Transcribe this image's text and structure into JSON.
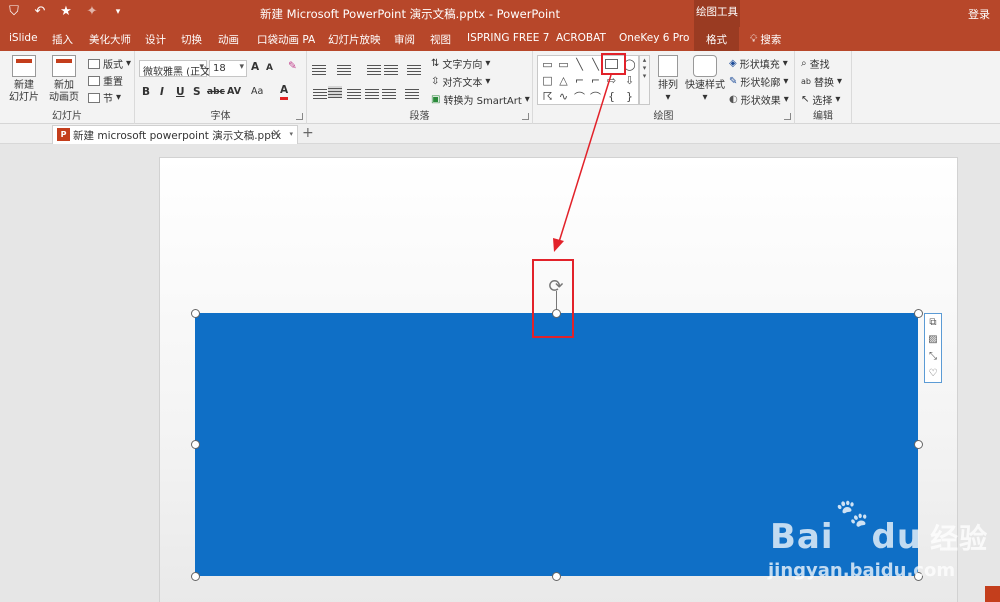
{
  "titlebar": {
    "title": "新建 Microsoft PowerPoint 演示文稿.pptx  -  PowerPoint",
    "context_tool": "绘图工具",
    "login": "登录"
  },
  "tabs": [
    {
      "label": "iSlide"
    },
    {
      "label": "插入"
    },
    {
      "label": "美化大师"
    },
    {
      "label": "设计"
    },
    {
      "label": "切换"
    },
    {
      "label": "动画"
    },
    {
      "label": "口袋动画 PA"
    },
    {
      "label": "幻灯片放映"
    },
    {
      "label": "审阅"
    },
    {
      "label": "视图"
    },
    {
      "label": "ISPRING FREE 7"
    },
    {
      "label": "ACROBAT"
    },
    {
      "label": "OneKey 6 Pro"
    },
    {
      "label": "格式"
    }
  ],
  "search_label": "搜索",
  "ribbon": {
    "slides": {
      "group_label": "幻灯片",
      "new_slide_line1": "新建",
      "new_slide_line2": "幻灯片",
      "new_anim_line1": "新加",
      "new_anim_line2": "动画页",
      "layout": "版式",
      "reset": "重置",
      "section": "节"
    },
    "font": {
      "group_label": "字体",
      "font_name": "微软雅黑 (正文",
      "font_size": "18",
      "bold": "B",
      "italic": "I",
      "underline": "U",
      "shadow": "S",
      "strike": "abc",
      "spacing": "AV",
      "case": "Aa",
      "color_a": "A",
      "grow": "A",
      "shrink": "A"
    },
    "paragraph": {
      "group_label": "段落",
      "text_direction": "文字方向",
      "align_text": "对齐文本",
      "convert_smartart": "转换为 SmartArt"
    },
    "drawing": {
      "group_label": "绘图",
      "arrange": "排列",
      "quick_styles": "快速样式",
      "shape_fill": "形状填充",
      "shape_outline": "形状轮廓",
      "shape_effects": "形状效果"
    },
    "editing": {
      "group_label": "编辑",
      "find": "查找",
      "replace": "替换",
      "select": "选择"
    }
  },
  "document": {
    "tab_name": "新建 microsoft powerpoint 演示文稿.pptx"
  },
  "watermark": {
    "brand": "Bai",
    "brand2": "du",
    "brand_cn": "经验",
    "url": "jingyan.baidu.com"
  },
  "colors": {
    "accent": "#b7472a",
    "shape_fill": "#0f6fc6",
    "highlight": "#e2222a"
  }
}
